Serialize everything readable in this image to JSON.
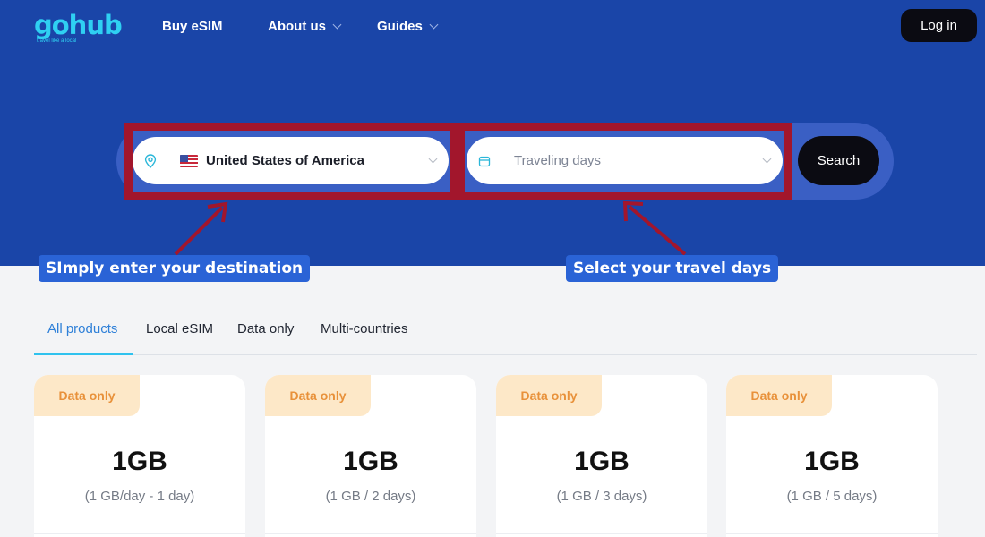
{
  "brand": {
    "logo_text": "gohub",
    "tagline": "travel like a local",
    "accent": "#2fd0f2",
    "hero_bg": "#1a45a8"
  },
  "nav": {
    "items": [
      {
        "label": "Buy eSIM",
        "has_dropdown": false
      },
      {
        "label": "About us",
        "has_dropdown": true
      },
      {
        "label": "Guides",
        "has_dropdown": true
      }
    ],
    "login_label": "Log in"
  },
  "search": {
    "destination_icon": "location-pin-icon",
    "destination_flag": "us-flag-icon",
    "destination_value": "United States of America",
    "days_icon": "calendar-icon",
    "days_placeholder": "Traveling days",
    "button_label": "Search"
  },
  "annotations": {
    "highlight_color": "#a2162c",
    "left_callout": "SImply enter your destination",
    "right_callout": "Select your travel days"
  },
  "tabs": [
    {
      "label": "All products",
      "active": true
    },
    {
      "label": "Local eSIM",
      "active": false
    },
    {
      "label": "Data only",
      "active": false
    },
    {
      "label": "Multi-countries",
      "active": false
    }
  ],
  "products": [
    {
      "badge": "Data only",
      "size": "1GB",
      "desc": "(1 GB/day - 1 day)"
    },
    {
      "badge": "Data only",
      "size": "1GB",
      "desc": "(1 GB / 2 days)"
    },
    {
      "badge": "Data only",
      "size": "1GB",
      "desc": "(1 GB / 3 days)"
    },
    {
      "badge": "Data only",
      "size": "1GB",
      "desc": "(1 GB / 5 days)"
    }
  ]
}
